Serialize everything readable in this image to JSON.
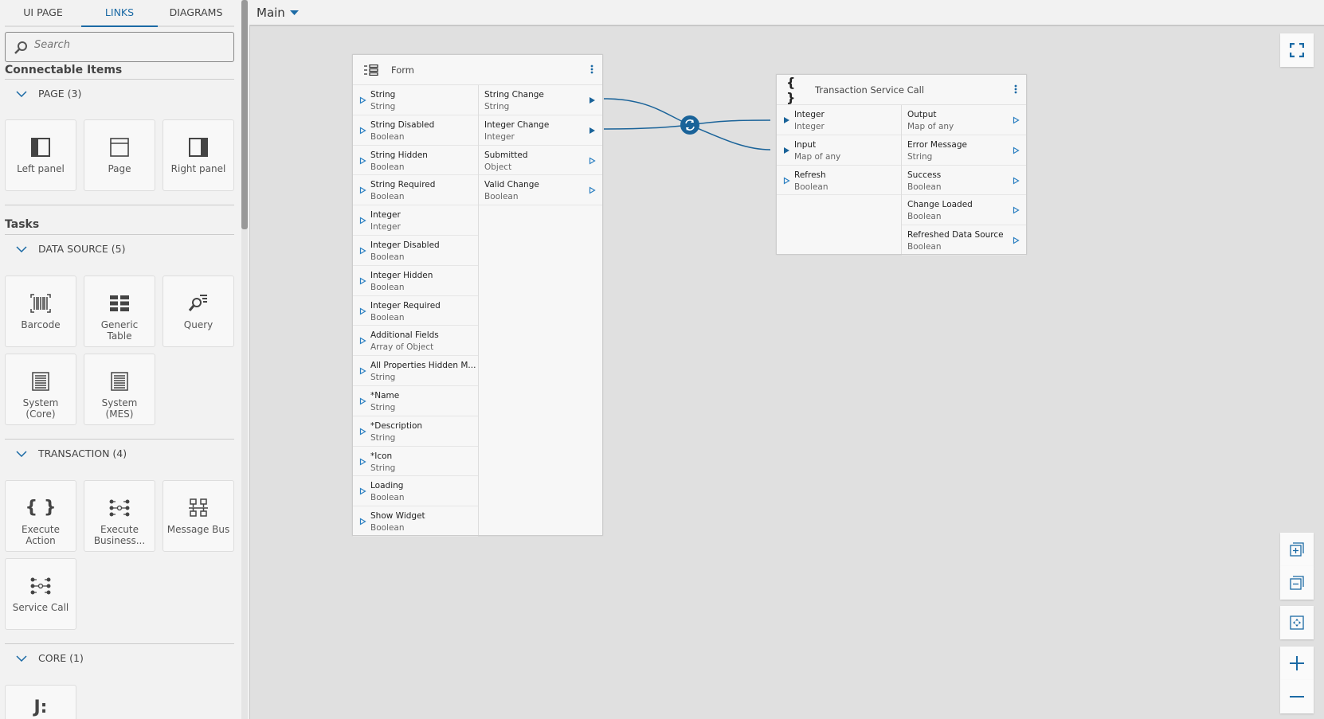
{
  "sidebar": {
    "tabs": [
      {
        "label": "UI PAGE"
      },
      {
        "label": "LINKS",
        "active": true
      },
      {
        "label": "DIAGRAMS"
      }
    ],
    "search": {
      "placeholder": "Search"
    },
    "connectable_heading": "Connectable Items",
    "tasks_heading": "Tasks",
    "groups": [
      {
        "label": "PAGE (3)",
        "items": [
          {
            "label": "Left panel",
            "icon": "left-panel-icon"
          },
          {
            "label": "Page",
            "icon": "page-icon"
          },
          {
            "label": "Right panel",
            "icon": "right-panel-icon"
          }
        ]
      },
      {
        "label": "DATA SOURCE (5)",
        "items": [
          {
            "label": "Barcode",
            "icon": "barcode-icon"
          },
          {
            "label": "Generic Table",
            "icon": "table-icon"
          },
          {
            "label": "Query",
            "icon": "query-icon"
          },
          {
            "label": "System (Core)",
            "icon": "document-icon"
          },
          {
            "label": "System (MES)",
            "icon": "document-icon"
          }
        ]
      },
      {
        "label": "TRANSACTION (4)",
        "items": [
          {
            "label": "Execute Action",
            "icon": "braces-icon"
          },
          {
            "label": "Execute Business...",
            "icon": "service-icon"
          },
          {
            "label": "Message Bus",
            "icon": "network-icon"
          },
          {
            "label": "Service Call",
            "icon": "service-icon"
          }
        ]
      },
      {
        "label": "CORE (1)",
        "items": [
          {
            "label": "",
            "icon": "json-icon"
          }
        ]
      }
    ]
  },
  "topbar": {
    "diagram": "Main"
  },
  "colors": {
    "accent": "#1b6aa5",
    "link": "#1a6399"
  },
  "nodes": {
    "form": {
      "title": "Form",
      "icon": "form-icon",
      "inputs": [
        {
          "name": "String",
          "type": "String"
        },
        {
          "name": "String Disabled",
          "type": "Boolean"
        },
        {
          "name": "String Hidden",
          "type": "Boolean"
        },
        {
          "name": "String Required",
          "type": "Boolean"
        },
        {
          "name": "Integer",
          "type": "Integer"
        },
        {
          "name": "Integer Disabled",
          "type": "Boolean"
        },
        {
          "name": "Integer Hidden",
          "type": "Boolean"
        },
        {
          "name": "Integer Required",
          "type": "Boolean"
        },
        {
          "name": "Additional Fields",
          "type": "Array of Object"
        },
        {
          "name": "All Properties Hidden M...",
          "type": "String"
        },
        {
          "name": "*Name",
          "type": "String"
        },
        {
          "name": "*Description",
          "type": "String"
        },
        {
          "name": "*Icon",
          "type": "String"
        },
        {
          "name": "Loading",
          "type": "Boolean"
        },
        {
          "name": "Show Widget",
          "type": "Boolean"
        }
      ],
      "outputs": [
        {
          "name": "String Change",
          "type": "String",
          "connected": true
        },
        {
          "name": "Integer Change",
          "type": "Integer",
          "connected": true
        },
        {
          "name": "Submitted",
          "type": "Object"
        },
        {
          "name": "Valid Change",
          "type": "Boolean"
        }
      ]
    },
    "service": {
      "title": "Transaction Service Call",
      "icon": "braces-icon",
      "inputs": [
        {
          "name": "Integer",
          "type": "Integer",
          "connected": true
        },
        {
          "name": "Input",
          "type": "Map of any",
          "connected": true
        },
        {
          "name": "Refresh",
          "type": "Boolean"
        }
      ],
      "outputs": [
        {
          "name": "Output",
          "type": "Map of any"
        },
        {
          "name": "Error Message",
          "type": "String"
        },
        {
          "name": "Success",
          "type": "Boolean"
        },
        {
          "name": "Change Loaded",
          "type": "Boolean"
        },
        {
          "name": "Refreshed Data Source",
          "type": "Boolean"
        }
      ]
    }
  }
}
